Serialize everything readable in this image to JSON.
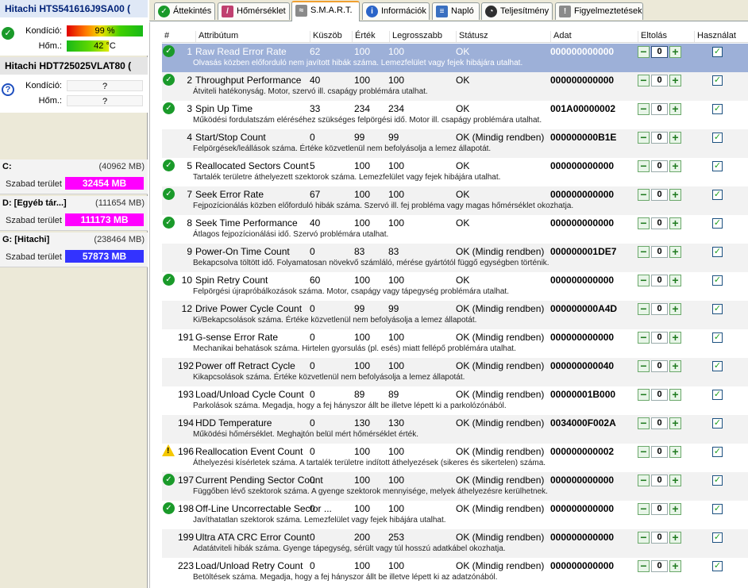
{
  "disks": [
    {
      "title": "Hitachi HTS541616J9SA00 (",
      "condition_label": "Kondíció:",
      "condition": "99 %",
      "condition_fraction": 0.99,
      "temp_label": "Hőm.:",
      "temp": "42 °C",
      "status": "ok"
    },
    {
      "title": "Hitachi HDT725025VLAT80 (",
      "condition_label": "Kondíció:",
      "condition": "?",
      "temp_label": "Hőm.:",
      "temp": "?",
      "status": "unknown"
    }
  ],
  "partitions": [
    {
      "name": "C:",
      "total": "(40962 MB)",
      "free_label": "Szabad terület",
      "free": "32454 MB",
      "color": "#ff00ff"
    },
    {
      "name": "D: [Egyéb tár...]",
      "total": "(111654 MB)",
      "free_label": "Szabad terület",
      "free": "111173 MB",
      "color": "#ff00ff"
    },
    {
      "name": "G: [Hitachi]",
      "total": "(238464 MB)",
      "free_label": "Szabad terület",
      "free": "57873 MB",
      "color": "#3333ff"
    }
  ],
  "tabs": [
    {
      "label": "Áttekintés",
      "icon": "check-circle-icon",
      "active": false
    },
    {
      "label": "Hőmérséklet",
      "icon": "thermometer-icon",
      "active": false
    },
    {
      "label": "S.M.A.R.T.",
      "icon": "smart-icon",
      "active": true
    },
    {
      "label": "Információk",
      "icon": "info-icon",
      "active": false
    },
    {
      "label": "Napló",
      "icon": "log-icon",
      "active": false
    },
    {
      "label": "Teljesítmény",
      "icon": "performance-icon",
      "active": false
    },
    {
      "label": "Figyelmeztetések",
      "icon": "warning-doc-icon",
      "active": false
    }
  ],
  "headers": {
    "num": "#",
    "attr": "Attribútum",
    "thr": "Küszöb",
    "val": "Érték",
    "worst": "Legrosszabb",
    "status": "Státusz",
    "data": "Adat",
    "offset": "Eltolás",
    "use": "Használat"
  },
  "rows": [
    {
      "num": "1",
      "name": "Raw Read Error Rate",
      "thr": "62",
      "val": "100",
      "worst": "100",
      "status": "OK",
      "raw": "000000000000",
      "offset": "0",
      "icon": "ok",
      "selected": true,
      "desc": "Olvasás közben előforduló nem javított hibák száma. Lemezfelület vagy fejek hibájára utalhat."
    },
    {
      "num": "2",
      "name": "Throughput Performance",
      "thr": "40",
      "val": "100",
      "worst": "100",
      "status": "OK",
      "raw": "000000000000",
      "offset": "0",
      "icon": "ok",
      "desc": "Átviteli hatékonyság. Motor, szervó ill. csapágy problémára utalhat."
    },
    {
      "num": "3",
      "name": "Spin Up Time",
      "thr": "33",
      "val": "234",
      "worst": "234",
      "status": "OK",
      "raw": "001A00000002",
      "offset": "0",
      "icon": "ok",
      "desc": "Működési fordulatszám eléréséhez szükséges felpörgési idő. Motor ill. csapágy problémára utalhat."
    },
    {
      "num": "4",
      "name": "Start/Stop Count",
      "thr": "0",
      "val": "99",
      "worst": "99",
      "status": "OK (Mindig rendben)",
      "raw": "000000000B1E",
      "offset": "0",
      "icon": "none",
      "desc": "Felpörgések/leállások száma. Értéke közvetlenül nem befolyásolja a lemez állapotát."
    },
    {
      "num": "5",
      "name": "Reallocated Sectors Count",
      "thr": "5",
      "val": "100",
      "worst": "100",
      "status": "OK",
      "raw": "000000000000",
      "offset": "0",
      "icon": "ok",
      "desc": "Tartalék területre áthelyezett szektorok száma. Lemezfelület vagy fejek hibájára utalhat."
    },
    {
      "num": "7",
      "name": "Seek Error Rate",
      "thr": "67",
      "val": "100",
      "worst": "100",
      "status": "OK",
      "raw": "000000000000",
      "offset": "0",
      "icon": "ok",
      "desc": "Fejpozícionálás közben előforduló hibák száma. Szervó ill. fej probléma vagy magas hőmérséklet okozhatja."
    },
    {
      "num": "8",
      "name": "Seek Time Performance",
      "thr": "40",
      "val": "100",
      "worst": "100",
      "status": "OK",
      "raw": "000000000000",
      "offset": "0",
      "icon": "ok",
      "desc": "Átlagos fejpozícionálási idő. Szervó problémára utalhat."
    },
    {
      "num": "9",
      "name": "Power-On Time Count",
      "thr": "0",
      "val": "83",
      "worst": "83",
      "status": "OK (Mindig rendben)",
      "raw": "000000001DE7",
      "offset": "0",
      "icon": "none",
      "desc": "Bekapcsolva töltött idő. Folyamatosan növekvő számláló, mérése gyártótól függő egységben történik."
    },
    {
      "num": "10",
      "name": "Spin Retry Count",
      "thr": "60",
      "val": "100",
      "worst": "100",
      "status": "OK",
      "raw": "000000000000",
      "offset": "0",
      "icon": "ok",
      "desc": "Felpörgési újrapróbálkozások száma. Motor, csapágy vagy tápegység problémára utalhat."
    },
    {
      "num": "12",
      "name": "Drive Power Cycle Count",
      "thr": "0",
      "val": "99",
      "worst": "99",
      "status": "OK (Mindig rendben)",
      "raw": "000000000A4D",
      "offset": "0",
      "icon": "none",
      "desc": "Ki/Bekapcsolások száma. Értéke közvetlenül nem befolyásolja a lemez állapotát."
    },
    {
      "num": "191",
      "name": "G-sense Error Rate",
      "thr": "0",
      "val": "100",
      "worst": "100",
      "status": "OK (Mindig rendben)",
      "raw": "000000000000",
      "offset": "0",
      "icon": "none",
      "desc": "Mechanikai behatások száma. Hirtelen gyorsulás (pl. esés) miatt fellépő problémára utalhat."
    },
    {
      "num": "192",
      "name": "Power off Retract Cycle",
      "thr": "0",
      "val": "100",
      "worst": "100",
      "status": "OK (Mindig rendben)",
      "raw": "000000000040",
      "offset": "0",
      "icon": "none",
      "desc": "Kikapcsolások száma. Értéke közvetlenül nem befolyásolja a lemez állapotát."
    },
    {
      "num": "193",
      "name": "Load/Unload Cycle Count",
      "thr": "0",
      "val": "89",
      "worst": "89",
      "status": "OK (Mindig rendben)",
      "raw": "00000001B000",
      "offset": "0",
      "icon": "none",
      "desc": "Parkolások száma. Megadja, hogy a fej hányszor állt be illetve lépett ki a parkolózónából."
    },
    {
      "num": "194",
      "name": "HDD Temperature",
      "thr": "0",
      "val": "130",
      "worst": "130",
      "status": "OK (Mindig rendben)",
      "raw": "0034000F002A",
      "offset": "0",
      "icon": "none",
      "desc": "Működési hőmérséklet. Meghajtón belül mért hőmérséklet érték."
    },
    {
      "num": "196",
      "name": "Reallocation Event Count",
      "thr": "0",
      "val": "100",
      "worst": "100",
      "status": "OK (Mindig rendben)",
      "raw": "000000000002",
      "offset": "0",
      "icon": "warn",
      "desc": "Áthelyezési kísérletek száma. A tartalék területre indított áthelyezések (sikeres és sikertelen) száma."
    },
    {
      "num": "197",
      "name": "Current Pending Sector Count",
      "thr": "0",
      "val": "100",
      "worst": "100",
      "status": "OK (Mindig rendben)",
      "raw": "000000000000",
      "offset": "0",
      "icon": "ok",
      "desc": "Függőben lévő szektorok száma. A gyenge szektorok mennyisége, melyek áthelyezésre kerülhetnek."
    },
    {
      "num": "198",
      "name": "Off-Line Uncorrectable Sector ...",
      "thr": "0",
      "val": "100",
      "worst": "100",
      "status": "OK (Mindig rendben)",
      "raw": "000000000000",
      "offset": "0",
      "icon": "ok",
      "desc": "Javíthatatlan szektorok száma. Lemezfelület vagy fejek hibájára utalhat."
    },
    {
      "num": "199",
      "name": "Ultra ATA CRC Error Count",
      "thr": "0",
      "val": "200",
      "worst": "253",
      "status": "OK (Mindig rendben)",
      "raw": "000000000000",
      "offset": "0",
      "icon": "none",
      "desc": "Adatátviteli hibák száma. Gyenge tápegység, sérült vagy túl hosszú adatkábel okozhatja."
    },
    {
      "num": "223",
      "name": "Load/Unload Retry Count",
      "thr": "0",
      "val": "100",
      "worst": "100",
      "status": "OK (Mindig rendben)",
      "raw": "000000000000",
      "offset": "0",
      "icon": "none",
      "desc": "Betöltések száma. Megadja, hogy a fej hányszor állt be illetve lépett ki az adatzónából."
    }
  ]
}
